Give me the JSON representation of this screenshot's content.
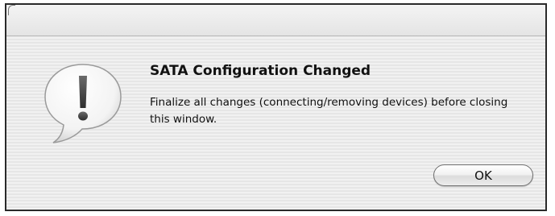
{
  "dialog": {
    "icon": "exclamation-speech-bubble-icon",
    "title": "SATA Configuration Changed",
    "message": "Finalize all changes (connecting/removing devices) before closing this window.",
    "buttons": {
      "ok_label": "OK"
    }
  }
}
